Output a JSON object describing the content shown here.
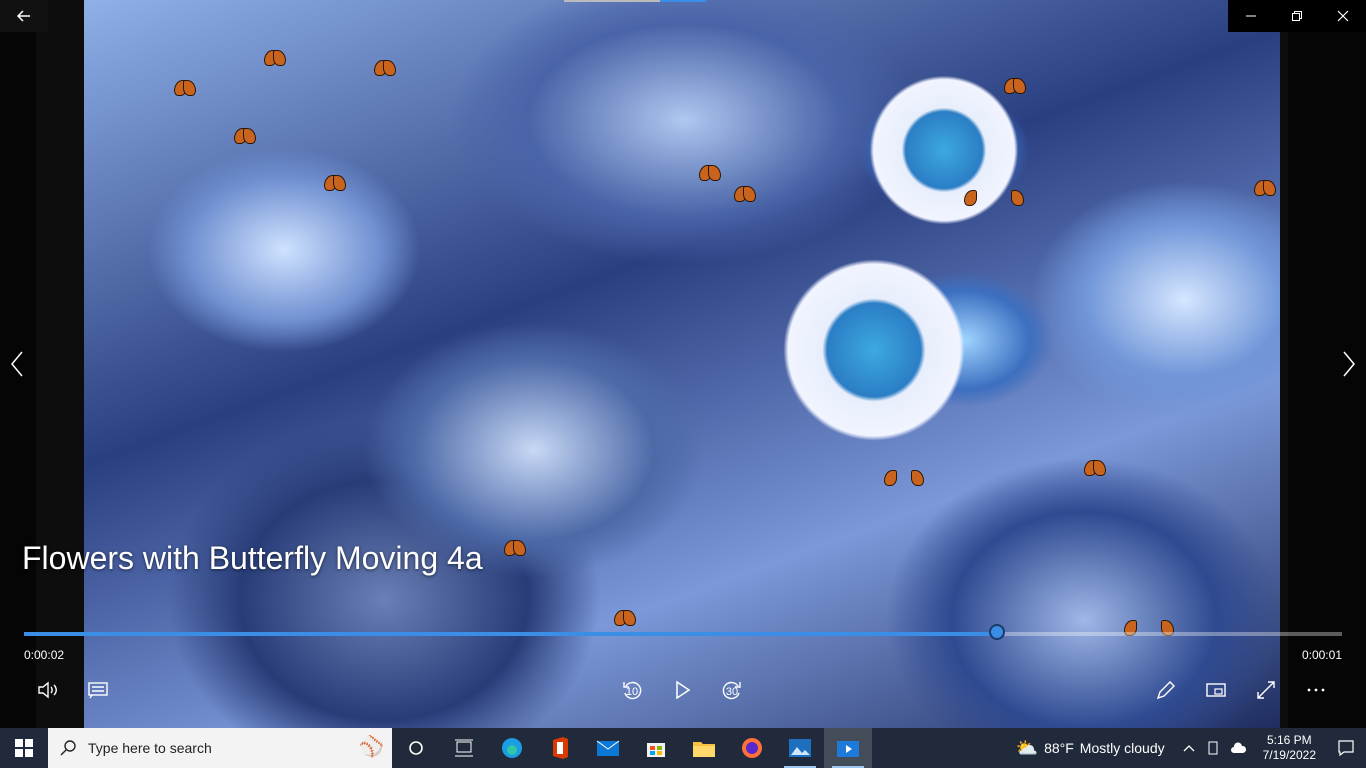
{
  "video": {
    "title": "Flowers with Butterfly Moving 4a"
  },
  "playback": {
    "elapsed": "0:00:02",
    "remaining": "0:00:01",
    "progress_fraction": 0.738
  },
  "controls": {
    "skip_back_label": "10",
    "skip_forward_label": "30"
  },
  "taskbar": {
    "search_placeholder": "Type here to search",
    "weather_temp": "88°F",
    "weather_desc": "Mostly cloudy",
    "time": "5:16 PM",
    "date": "7/19/2022"
  },
  "icons": {
    "back": "back-arrow-icon",
    "minimize": "minimize-icon",
    "restore": "restore-icon",
    "close": "close-icon",
    "volume": "volume-icon",
    "subtitles": "subtitles-icon",
    "play": "play-icon",
    "edit": "pen-icon",
    "miniview": "mini-view-icon",
    "fullscreen": "fullscreen-icon",
    "more": "more-icon"
  },
  "colors": {
    "accent": "#3a8ee6",
    "taskbar": "#202a3a"
  }
}
